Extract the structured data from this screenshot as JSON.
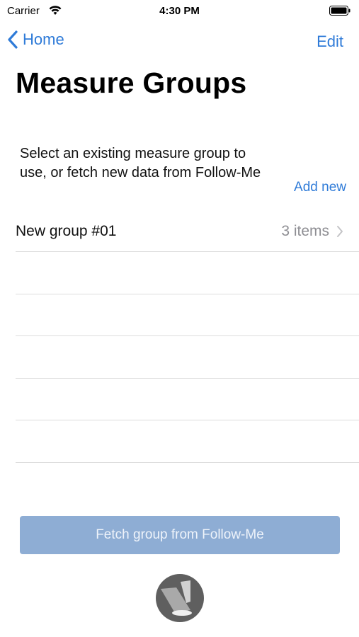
{
  "status_bar": {
    "carrier": "Carrier",
    "time": "4:30 PM",
    "icons": [
      "wifi-icon",
      "battery-icon"
    ]
  },
  "nav": {
    "back_label": "Home",
    "edit_label": "Edit"
  },
  "title": "Measure Groups",
  "intro": {
    "text": "Select an existing measure group to use, or fetch new data from Follow-Me",
    "add_new": "Add new"
  },
  "groups": [
    {
      "name": "New group #01",
      "detail": "3 items"
    }
  ],
  "fetch_button": "Fetch group from Follow-Me",
  "colors": {
    "accent": "#2f7bd8",
    "button_bg": "#8eadd4",
    "separator": "#dcdcdc",
    "detail_text": "#8e8e93"
  },
  "icons": {
    "back": "chevron-left-icon",
    "row": "chevron-right-icon",
    "logo": "follow-me-logo-icon"
  }
}
